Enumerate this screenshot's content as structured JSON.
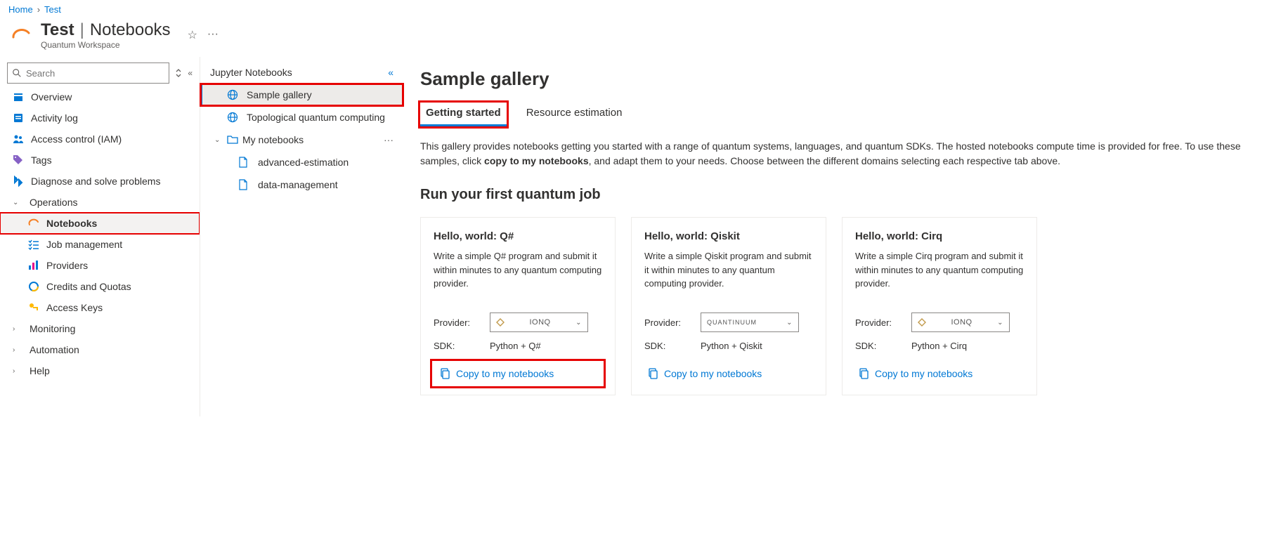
{
  "breadcrumb": {
    "home": "Home",
    "current": "Test"
  },
  "header": {
    "title_main": "Test",
    "title_sub": "Notebooks",
    "subtitle": "Quantum Workspace"
  },
  "search": {
    "placeholder": "Search"
  },
  "sidebar": {
    "overview": "Overview",
    "activity": "Activity log",
    "access": "Access control (IAM)",
    "tags": "Tags",
    "diagnose": "Diagnose and solve problems",
    "operations": "Operations",
    "notebooks": "Notebooks",
    "jobmgmt": "Job management",
    "providers": "Providers",
    "credits": "Credits and Quotas",
    "keys": "Access Keys",
    "monitoring": "Monitoring",
    "automation": "Automation",
    "help": "Help"
  },
  "mid": {
    "title": "Jupyter Notebooks",
    "sample_gallery": "Sample gallery",
    "topological": "Topological quantum computing",
    "my_notebooks": "My notebooks",
    "file1": "advanced-estimation",
    "file2": "data-management"
  },
  "main": {
    "title": "Sample gallery",
    "tab_getting": "Getting started",
    "tab_resource": "Resource estimation",
    "desc_pre": "This gallery provides notebooks getting you started with a range of quantum systems, languages, and quantum SDKs. The hosted notebooks compute time is provided for free. To use these samples, click ",
    "desc_bold": "copy to my notebooks",
    "desc_post": ", and adapt them to your needs. Choose between the different domains selecting each respective tab above.",
    "section_title": "Run your first quantum job",
    "provider_label": "Provider:",
    "sdk_label": "SDK:",
    "copy_label": "Copy to my notebooks",
    "cards": [
      {
        "title": "Hello, world: Q#",
        "desc": "Write a simple Q# program and submit it within minutes to any quantum computing provider.",
        "provider": "IONQ",
        "sdk": "Python + Q#"
      },
      {
        "title": "Hello, world: Qiskit",
        "desc": "Write a simple Qiskit program and submit it within minutes to any quantum computing provider.",
        "provider": "QUANTINUUM",
        "sdk": "Python + Qiskit"
      },
      {
        "title": "Hello, world: Cirq",
        "desc": "Write a simple Cirq program and submit it within minutes to any quantum computing provider.",
        "provider": "IONQ",
        "sdk": "Python + Cirq"
      }
    ]
  }
}
